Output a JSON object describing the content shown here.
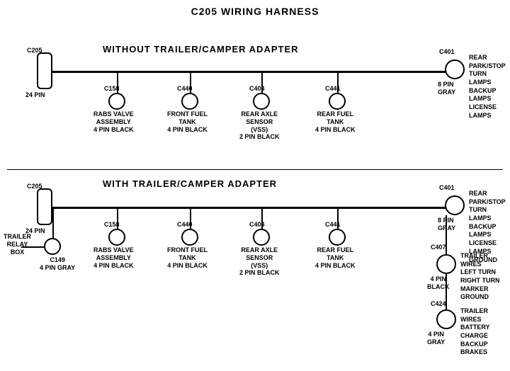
{
  "title": "C205 WIRING HARNESS",
  "section1": {
    "label": "WITHOUT  TRAILER/CAMPER ADAPTER",
    "connectors": [
      {
        "id": "C205_top",
        "pin": "C205",
        "pinDetail": "24 PIN"
      },
      {
        "id": "C401_top",
        "pin": "C401",
        "pinDetail": "8 PIN\nGRAY"
      },
      {
        "id": "C158_top",
        "pin": "C158",
        "detail": "RABS VALVE\nASSEMBLY\n4 PIN BLACK"
      },
      {
        "id": "C440_top",
        "pin": "C440",
        "detail": "FRONT FUEL\nTANK\n4 PIN BLACK"
      },
      {
        "id": "C404_top",
        "pin": "C404",
        "detail": "REAR AXLE\nSENSOR\n(VSS)\n2 PIN BLACK"
      },
      {
        "id": "C441_top",
        "pin": "C441",
        "detail": "REAR FUEL\nTANK\n4 PIN BLACK"
      }
    ],
    "rightLabel": "REAR PARK/STOP\nTURN LAMPS\nBACKUP LAMPS\nLICENSE LAMPS"
  },
  "section2": {
    "label": "WITH  TRAILER/CAMPER ADAPTER",
    "connectors": [
      {
        "id": "C205_bot",
        "pin": "C205",
        "pinDetail": "24 PIN"
      },
      {
        "id": "C401_bot",
        "pin": "C401",
        "pinDetail": "8 PIN\nGRAY"
      },
      {
        "id": "C158_bot",
        "pin": "C158",
        "detail": "RABS VALVE\nASSEMBLY\n4 PIN BLACK"
      },
      {
        "id": "C440_bot",
        "pin": "C440",
        "detail": "FRONT FUEL\nTANK\n4 PIN BLACK"
      },
      {
        "id": "C404_bot",
        "pin": "C404",
        "detail": "REAR AXLE\nSENSOR\n(VSS)\n2 PIN BLACK"
      },
      {
        "id": "C441_bot",
        "pin": "C441",
        "detail": "REAR FUEL\nTANK\n4 PIN BLACK"
      },
      {
        "id": "C149_bot",
        "pin": "C149",
        "detail": "4 PIN GRAY"
      },
      {
        "id": "C407_bot",
        "pin": "C407",
        "detail": "4 PIN\nBLACK"
      },
      {
        "id": "C424_bot",
        "pin": "C424",
        "detail": "4 PIN\nGRAY"
      }
    ],
    "rightLabel1": "REAR PARK/STOP\nTURN LAMPS\nBACKUP LAMPS\nLICENSE LAMPS\nGROUND",
    "rightLabel2": "TRAILER WIRES\nLEFT TURN\nRIGHT TURN\nMARKER\nGROUND",
    "rightLabel3": "TRAILER WIRES\nBATTERY CHARGE\nBACKUP\nBRAKES",
    "trailerRelayLabel": "TRAILER\nRELAY\nBOX"
  }
}
